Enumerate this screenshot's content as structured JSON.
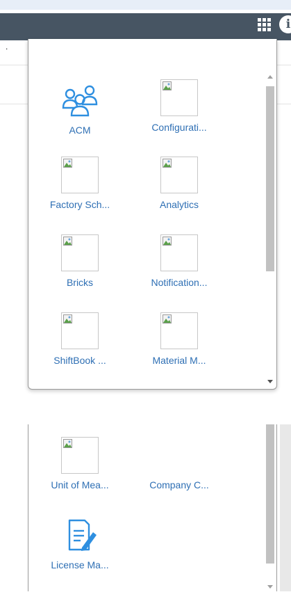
{
  "header": {
    "apps_icon": "grid-icon",
    "info_icon": "info-icon",
    "info_glyph": "i",
    "header_color": "#475563"
  },
  "page": {
    "stray_mark": "."
  },
  "app_launcher": {
    "label_color": "#2e6fb4",
    "apps": [
      {
        "label": "ACM",
        "icon": "users-group-icon"
      },
      {
        "label": "Configurati...",
        "icon": "broken-image-icon"
      },
      {
        "label": "Factory Sch...",
        "icon": "broken-image-icon"
      },
      {
        "label": "Analytics",
        "icon": "broken-image-icon"
      },
      {
        "label": "Bricks",
        "icon": "broken-image-icon"
      },
      {
        "label": "Notification...",
        "icon": "broken-image-icon"
      },
      {
        "label": "ShiftBook ...",
        "icon": "broken-image-icon"
      },
      {
        "label": "Material M...",
        "icon": "broken-image-icon"
      }
    ]
  },
  "app_launcher_scrolled": {
    "apps": [
      {
        "label": "Unit of Mea...",
        "icon": "broken-image-icon"
      },
      {
        "label": "Company C...",
        "icon": "none"
      },
      {
        "label": "License Ma...",
        "icon": "license-edit-icon"
      }
    ]
  }
}
